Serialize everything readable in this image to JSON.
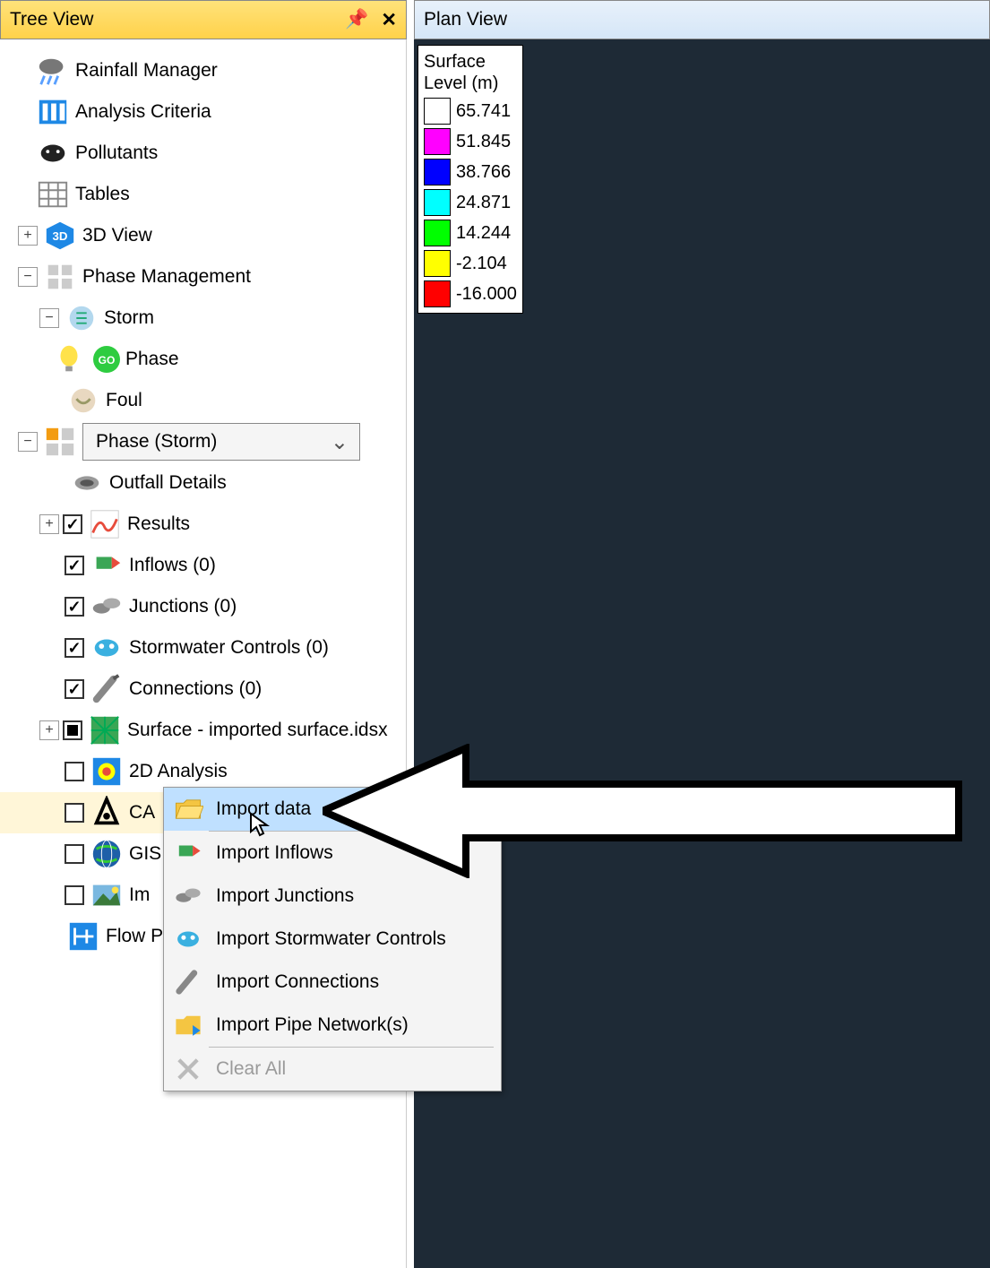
{
  "treeview": {
    "title": "Tree View",
    "pin_glyph": "📌",
    "close_glyph": "✕",
    "items": {
      "rainfall": "Rainfall Manager",
      "analysis_criteria": "Analysis Criteria",
      "pollutants": "Pollutants",
      "tables": "Tables",
      "view3d": "3D View",
      "phase_management": "Phase Management",
      "storm": "Storm",
      "phase": "Phase",
      "foul": "Foul",
      "phase_dropdown": "Phase (Storm)",
      "outfall": "Outfall Details",
      "results": "Results",
      "inflows": "Inflows (0)",
      "junctions": "Junctions (0)",
      "stormwater": "Stormwater Controls (0)",
      "connections": "Connections (0)",
      "surface": "Surface - imported surface.idsx",
      "analysis2d": "2D Analysis",
      "cad": "CA",
      "gis": "GIS",
      "im": "Im",
      "flow": "Flow P"
    }
  },
  "planview": {
    "title": "Plan View",
    "legend": {
      "title_line1": "Surface",
      "title_line2": "Level (m)",
      "rows": [
        {
          "color": "#ffffff",
          "value": "65.741"
        },
        {
          "color": "#ff00ff",
          "value": "51.845"
        },
        {
          "color": "#0000ff",
          "value": "38.766"
        },
        {
          "color": "#00ffff",
          "value": "24.871"
        },
        {
          "color": "#00ff00",
          "value": "14.244"
        },
        {
          "color": "#ffff00",
          "value": "-2.104"
        },
        {
          "color": "#ff0000",
          "value": "-16.000"
        }
      ]
    }
  },
  "context_menu": {
    "import_data": "Import data",
    "import_inflows": "Import Inflows",
    "import_junctions": "Import Junctions",
    "import_stormwater": "Import Stormwater Controls",
    "import_connections": "Import Connections",
    "import_pipe": "Import Pipe Network(s)",
    "clear_all": "Clear All"
  }
}
